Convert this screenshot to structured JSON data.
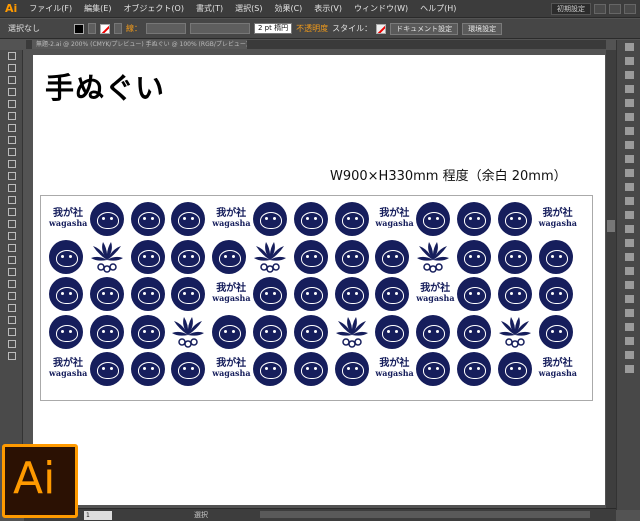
{
  "app": {
    "logo": "Ai",
    "brand_color": "#ff9a00"
  },
  "menu": {
    "items": [
      "ファイル(F)",
      "編集(E)",
      "オブジェクト(O)",
      "書式(T)",
      "選択(S)",
      "効果(C)",
      "表示(V)",
      "ウィンドウ(W)",
      "ヘルプ(H)"
    ],
    "workspace_label": "初期設定"
  },
  "control": {
    "selection": "選択なし",
    "stroke_label": "線：",
    "stroke_weight": "2 pt 楕円",
    "opacity_label": "不透明度",
    "style_label": "スタイル：",
    "doc_settings_btn": "ドキュメント設定",
    "env_settings_btn": "環境設定"
  },
  "document": {
    "tab_title": "無題-2.ai @ 200% (CMYK/プレビュー) 手ぬぐい @ 100% (RGB/プレビュー)"
  },
  "artboard": {
    "title": "手ぬぐい",
    "dimensions": "W900×H330mm 程度（余白 20mm）"
  },
  "towel": {
    "brand_line1": "我が社",
    "brand_line2": "wagasha",
    "ink_color": "#161e5c"
  },
  "status": {
    "zoom": "1",
    "tool": "選択"
  },
  "icons": [
    "arrow-icon",
    "direct-select-icon",
    "magic-wand-icon",
    "lasso-icon",
    "pen-icon",
    "type-icon",
    "line-icon",
    "rectangle-icon",
    "brush-icon",
    "pencil-icon",
    "eraser-icon",
    "rotate-icon",
    "scale-icon",
    "warp-icon",
    "shape-builder-icon",
    "perspective-icon",
    "mesh-icon",
    "gradient-icon",
    "eyedropper-icon",
    "blend-icon",
    "symbol-sprayer-icon",
    "graph-icon",
    "artboard-icon",
    "slice-icon",
    "hand-icon",
    "zoom-icon"
  ]
}
